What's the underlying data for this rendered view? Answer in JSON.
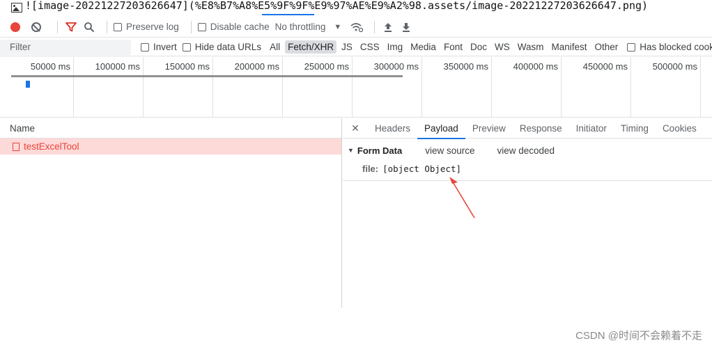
{
  "markdown_line": {
    "text": "![image-20221227203626647](%E8%B7%A8%E5%9F%9F%E9%97%AE%E9%A2%98.assets/image-20221227203626647.png)"
  },
  "toolbar": {
    "preserve_log": "Preserve log",
    "disable_cache": "Disable cache",
    "throttling": "No throttling",
    "icons": [
      "record-icon",
      "clear-icon",
      "filter-icon",
      "search-icon",
      "wifi-settings-icon",
      "upload-icon",
      "download-icon"
    ]
  },
  "filter": {
    "placeholder": "Filter",
    "invert": "Invert",
    "hide_data_urls": "Hide data URLs",
    "types": [
      "All",
      "Fetch/XHR",
      "JS",
      "CSS",
      "Img",
      "Media",
      "Font",
      "Doc",
      "WS",
      "Wasm",
      "Manifest",
      "Other"
    ],
    "active_type": "Fetch/XHR",
    "blocked_cookies": "Has blocked cookies"
  },
  "timeline": {
    "ticks": [
      "50000 ms",
      "100000 ms",
      "150000 ms",
      "200000 ms",
      "250000 ms",
      "300000 ms",
      "350000 ms",
      "400000 ms",
      "450000 ms",
      "500000 ms"
    ]
  },
  "requests": {
    "header_name": "Name",
    "rows": [
      {
        "name": "testExcelTool",
        "status": "error"
      }
    ]
  },
  "detail": {
    "tabs": [
      "Headers",
      "Payload",
      "Preview",
      "Response",
      "Initiator",
      "Timing",
      "Cookies"
    ],
    "active_tab": "Payload",
    "section_title": "Form Data",
    "view_source": "view source",
    "view_decoded": "view decoded",
    "fields": [
      {
        "key": "file:",
        "value": "[object Object]"
      }
    ]
  },
  "colors": {
    "error_row_bg": "#fdd9d7",
    "error_text": "#e8453c",
    "accent": "#1a73e8",
    "annotation_arrow": "#e8453c"
  },
  "watermark": "CSDN @时间不会赖着不走"
}
